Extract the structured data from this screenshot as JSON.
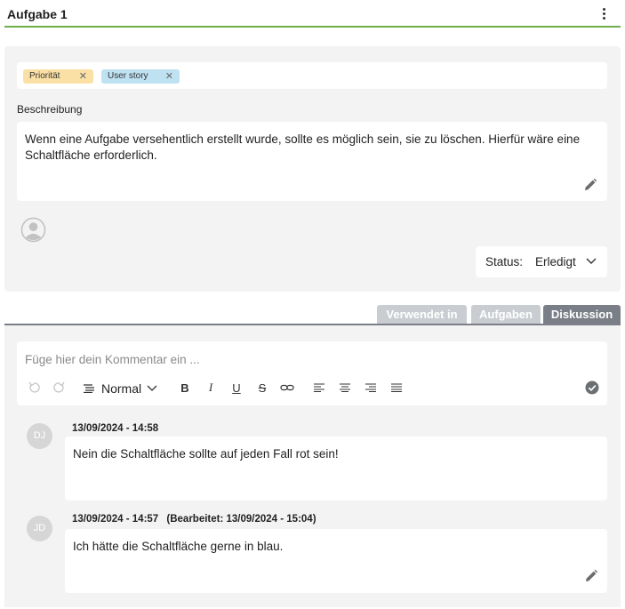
{
  "header": {
    "title": "Aufgabe 1",
    "menu_icon": "more-vertical-icon"
  },
  "tags": [
    {
      "label": "Priorität",
      "color": "#fbe0a6"
    },
    {
      "label": "User story",
      "color": "#bfe2f2"
    }
  ],
  "description": {
    "label": "Beschreibung",
    "text": "Wenn eine Aufgabe versehentlich erstellt wurde, sollte es möglich sein, sie zu löschen. Hierfür wäre eine Schaltfläche erforderlich."
  },
  "status": {
    "label": "Status:",
    "value": "Erledigt"
  },
  "tabs": [
    {
      "label": "Verwendet in",
      "active": false
    },
    {
      "label": "Aufgaben",
      "active": false
    },
    {
      "label": "Diskussion",
      "active": true
    }
  ],
  "editor": {
    "placeholder": "Füge hier dein Kommentar ein ...",
    "format_value": "Normal"
  },
  "comments": [
    {
      "initials": "DJ",
      "timestamp": "13/09/2024 - 14:58",
      "edited": "",
      "text": "Nein die Schaltfläche sollte auf jeden Fall rot sein!"
    },
    {
      "initials": "JD",
      "timestamp": "13/09/2024 - 14:57",
      "edited": "(Bearbeitet: 13/09/2024 - 15:04)",
      "text": "Ich hätte die Schaltfläche gerne in blau."
    }
  ],
  "colors": {
    "accent": "#6fae48",
    "active_tab": "#7a7f87",
    "inactive_tab": "#c9cdd2"
  }
}
